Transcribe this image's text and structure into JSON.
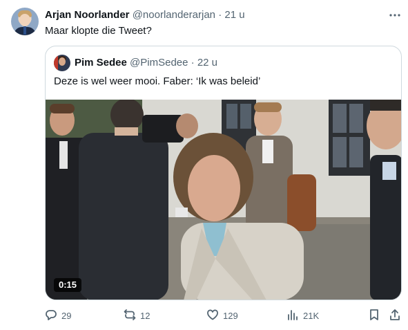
{
  "tweet": {
    "author": {
      "name": "Arjan Noorlander",
      "handle": "@noorlanderarjan",
      "separator": "·",
      "time": "21 u"
    },
    "text": "Maar klopte die Tweet?",
    "more_icon": "more-horizontal-icon"
  },
  "quoted_tweet": {
    "author": {
      "name": "Pim Sedee",
      "handle": "@PimSedee",
      "separator": "·",
      "time": "22 u"
    },
    "text": "Deze is wel weer mooi. Faber: ‘Ik was beleid’",
    "video": {
      "duration": "0:15"
    }
  },
  "actions": {
    "reply": {
      "icon": "reply-icon",
      "count": "29"
    },
    "retweet": {
      "icon": "retweet-icon",
      "count": "12"
    },
    "like": {
      "icon": "heart-icon",
      "count": "129"
    },
    "views": {
      "icon": "views-icon",
      "count": "21K"
    },
    "bookmark": {
      "icon": "bookmark-icon"
    },
    "share": {
      "icon": "share-icon"
    }
  },
  "colors": {
    "text_primary": "#0f1419",
    "text_secondary": "#536471",
    "border": "#cfd9de"
  }
}
